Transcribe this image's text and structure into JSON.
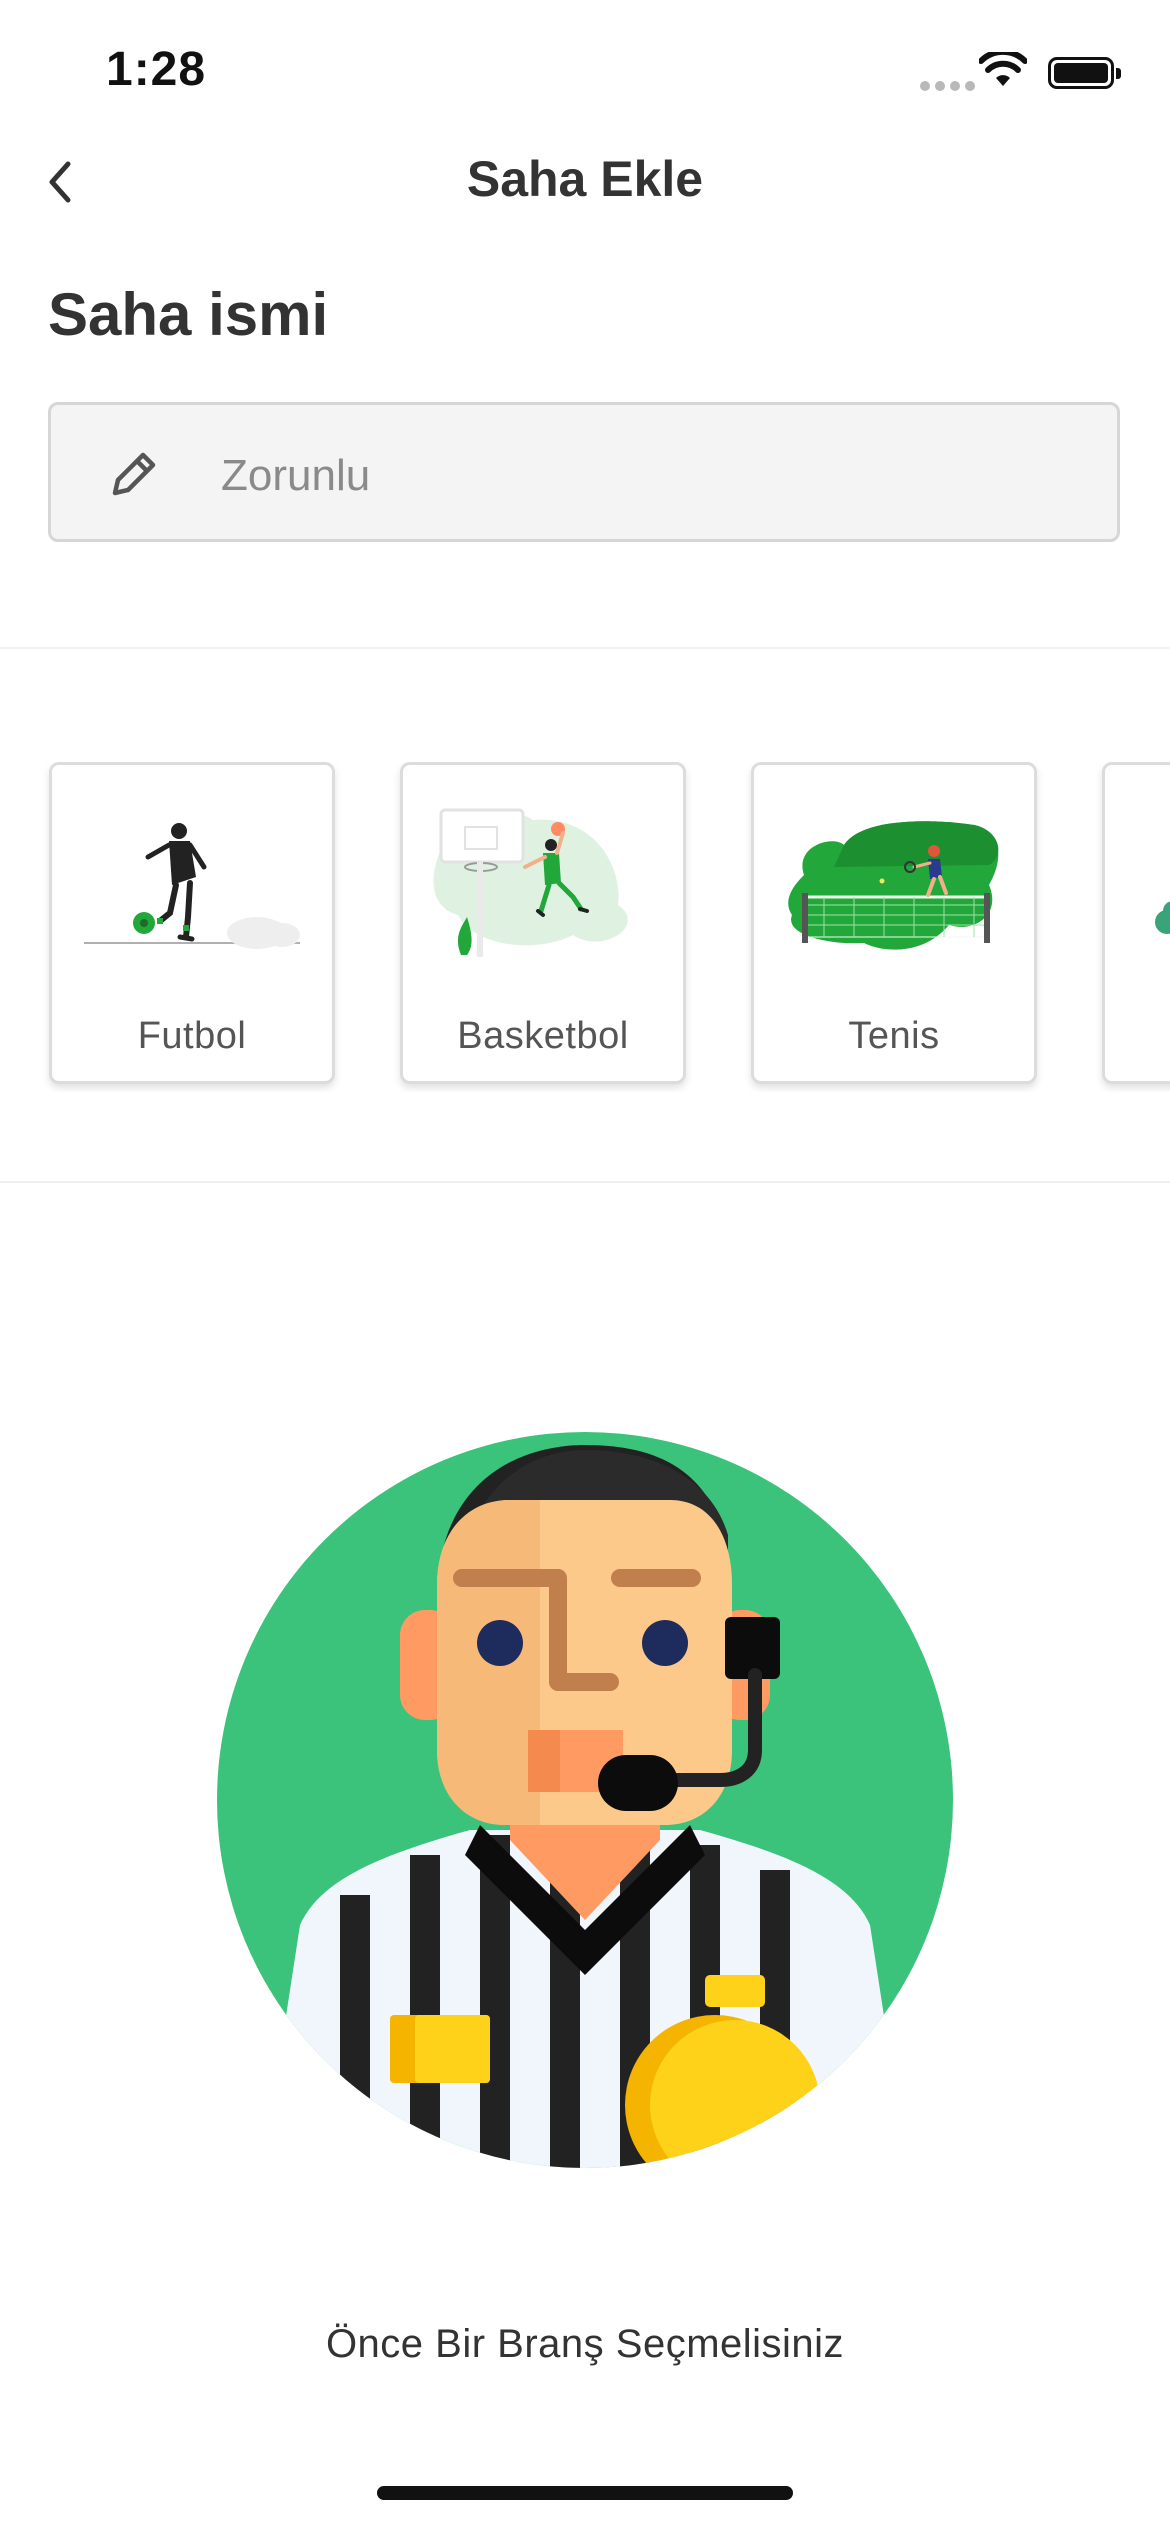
{
  "status_bar": {
    "time": "1:28"
  },
  "navbar": {
    "title": "Saha Ekle"
  },
  "form": {
    "label": "Saha ismi",
    "placeholder": "Zorunlu",
    "value": ""
  },
  "sports": [
    {
      "name": "Futbol"
    },
    {
      "name": "Basketbol"
    },
    {
      "name": "Tenis"
    },
    {
      "name": ""
    }
  ],
  "empty_state": {
    "message": "Önce Bir Branş Seçmelisiniz"
  },
  "colors": {
    "accent_green": "#3bc27b",
    "green": "#22a83a",
    "input_bg": "#f4f4f4",
    "text": "#333333"
  }
}
